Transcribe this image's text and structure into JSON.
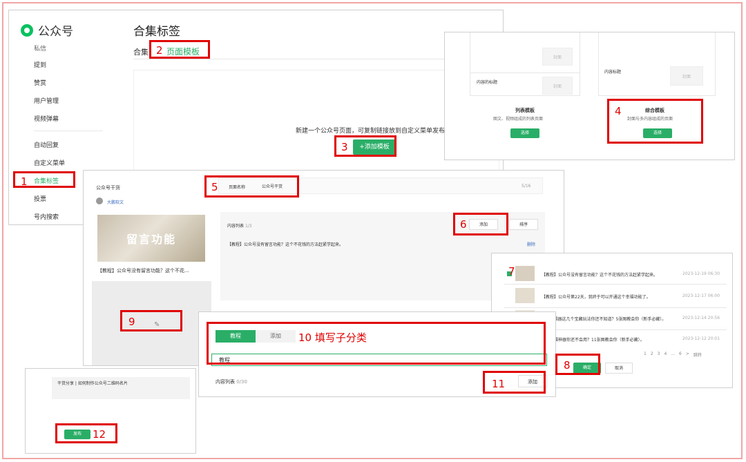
{
  "panel1": {
    "logo_text": "公众号",
    "page_title": "合集标签",
    "tab_prefix": "合集",
    "tab_template": "页面模板",
    "sidebar_items": [
      "私信",
      "提到",
      "赞赏",
      "用户管理",
      "视频弹幕",
      "自动回复",
      "自定义菜单",
      "合集标签",
      "投票",
      "号内搜索"
    ],
    "empty_text": "新建一个公众号页面，可复制链接放到自定义菜单发布",
    "add_template_button": "+添加模板"
  },
  "panel2": {
    "cover_label": "封面",
    "content_title_1": "内容的标题",
    "content_title_2": "内容标题",
    "list_template_title": "列表模板",
    "list_template_desc": "图文、视频组成的列表页面",
    "combo_template_title": "综合模板",
    "combo_template_desc": "封面与多内容组成的页面",
    "select_button": "选择"
  },
  "panel3": {
    "preview_title": "公众号干货",
    "author": "大鹏软文",
    "thumb_text": "留言功能",
    "article_caption": "【教程】公众号没有留言功能？这个不花...",
    "page_name_label": "页面名称",
    "page_name_value": "公众号干货",
    "page_name_count": "5/16",
    "content_list_label": "内容列表",
    "content_list_count": "1/3",
    "add_button": "添加",
    "sort_button": "排序",
    "list_item": "【教程】公众号没有留言功能？这个不花钱的方法赶紧学起来。",
    "delete_link": "删除",
    "edit_icon": "pencil-icon"
  },
  "panel4": {
    "articles": [
      {
        "title": "【教程】公众号没有留言功能？这个不花钱的方法赶紧学起来。",
        "date": "2023-12-19 06:30"
      },
      {
        "title": "【教程】公众号第22天，我终于可以开通这个幸福功能了。",
        "date": "2023-12-17 06:00"
      },
      {
        "title": "135编辑器这几个宝藏玩法你还不知道？5张图教会你（新手必藏）。",
        "date": "2023-12-14 20:56"
      },
      {
        "title": "这个编辑神器你还不会用？11张图教会你（新手必藏）。",
        "date": "2023-12-12 20:01"
      }
    ],
    "pagination": [
      "1",
      "2",
      "3",
      "4",
      "...",
      "6",
      ">",
      "跳转"
    ],
    "confirm_button": "确定",
    "cancel_button": "取消"
  },
  "panel5": {
    "tab_active": "教程",
    "tab_add": "添加",
    "subcategory_value": "教程",
    "content_list_label": "内容列表",
    "content_list_count": "0/30",
    "add_button": "添加"
  },
  "panel6": {
    "article_text": "干货分享 | 如何制作公众号二维码名片",
    "publish_button": "发布"
  },
  "annotations": {
    "n1": "1",
    "n2": "2",
    "n3": "3",
    "n4": "4",
    "n5": "5",
    "n6": "6",
    "n7": "7",
    "n8": "8",
    "n9": "9",
    "n10": "10",
    "n10_text": "填写子分类",
    "n11": "11",
    "n12": "12"
  },
  "colors": {
    "accent": "#2aae67",
    "annotation": "#e00000",
    "frame": "#f2a5a5"
  }
}
